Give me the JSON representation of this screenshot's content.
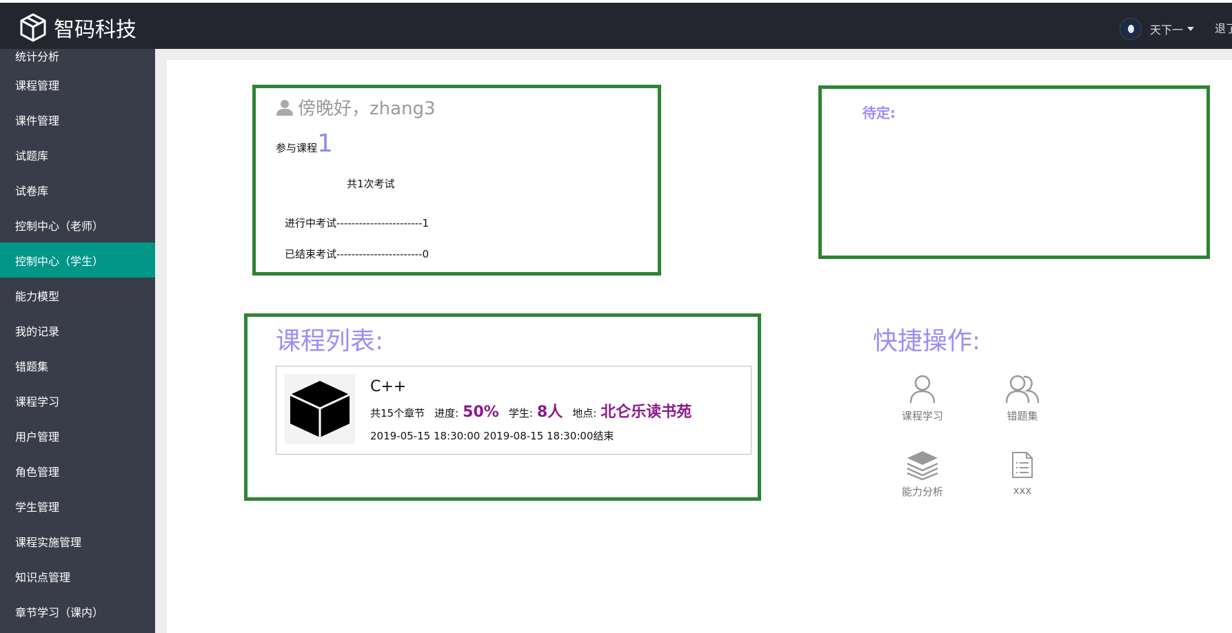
{
  "header": {
    "logo_text": "智码科技",
    "user_name": "天下一",
    "logout": "退了"
  },
  "sidebar": {
    "partial_top": "统计分析",
    "items": [
      {
        "label": "课程管理"
      },
      {
        "label": "课件管理"
      },
      {
        "label": "试题库"
      },
      {
        "label": "试卷库"
      },
      {
        "label": "控制中心（老师）"
      },
      {
        "label": "控制中心（学生）",
        "active": true
      },
      {
        "label": "能力模型"
      },
      {
        "label": "我的记录"
      },
      {
        "label": "错题集"
      },
      {
        "label": "课程学习"
      },
      {
        "label": "用户管理"
      },
      {
        "label": "角色管理"
      },
      {
        "label": "学生管理"
      },
      {
        "label": "课程实施管理"
      },
      {
        "label": "知识点管理"
      },
      {
        "label": "章节学习（课内）"
      }
    ]
  },
  "welcome": {
    "greeting": "傍晚好，zhang3",
    "courses_label": "参与课程",
    "courses_count": "1",
    "exam_total": "共1次考试",
    "in_progress": "进行中考试-----------------------1",
    "finished": "已结束考试-----------------------0"
  },
  "pending": {
    "title": "待定:"
  },
  "course_list": {
    "title": "课程列表:",
    "course": {
      "name": "C++",
      "chapters": "共15个章节",
      "progress_label": "进度:",
      "progress_value": "50%",
      "students_label": "学生:",
      "students_value": "8人",
      "location_label": "地点:",
      "location_value": "北仑乐读书苑",
      "dates": "2019-05-15  18:30:00    2019-08-15  18:30:00结束"
    }
  },
  "quick_actions": {
    "title": "快捷操作:",
    "items": [
      {
        "label": "课程学习",
        "icon": "person-icon"
      },
      {
        "label": "错题集",
        "icon": "group-icon"
      },
      {
        "label": "能力分析",
        "icon": "layers-icon"
      },
      {
        "label": "xxx",
        "icon": "document-icon"
      }
    ]
  },
  "colors": {
    "header_bg": "#23262e",
    "sidebar_bg": "#393d49",
    "sidebar_active": "#009688",
    "box_border": "#2f8433",
    "accent_purple": "#9b8ef5",
    "highlight": "#8b1a8b"
  }
}
